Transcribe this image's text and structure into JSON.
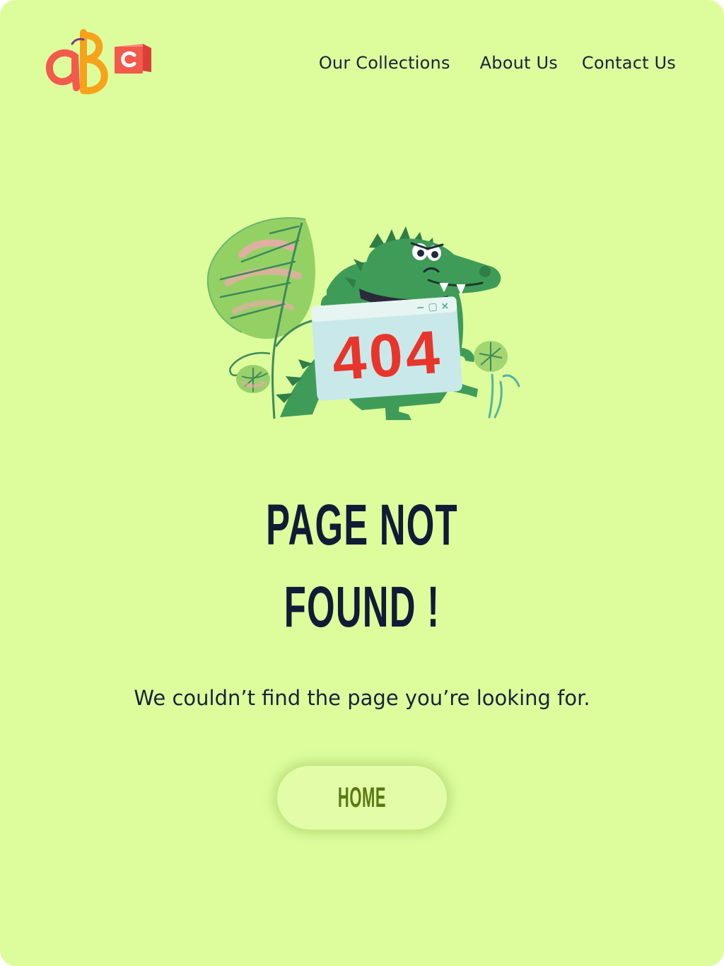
{
  "logo": {
    "letters": "abc",
    "colors": {
      "a": "#f25a4c",
      "b": "#f7a21b",
      "c_cube": "#f25a4c",
      "c_letter": "#ffffff"
    }
  },
  "nav": {
    "items": [
      {
        "label": "Our Collections"
      },
      {
        "label": "About Us"
      },
      {
        "label": "Contact Us"
      }
    ]
  },
  "illustration": {
    "icon": "crocodile-404-icon",
    "sign_text": "404",
    "window_controls": "− ▢ ×"
  },
  "main": {
    "title_line1": "PAGE NOT",
    "title_line2": "FOUND !",
    "message": "We couldn’t find the page you’re looking for.",
    "home_button": "HOME"
  },
  "colors": {
    "background": "#ddfd9d",
    "text_dark": "#17233a",
    "button_text": "#5a7812",
    "accent_red": "#e8352c",
    "croc_green": "#3e9c58"
  }
}
